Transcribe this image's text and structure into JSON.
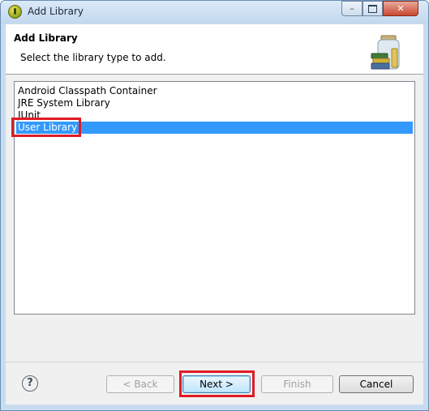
{
  "window": {
    "title": "Add Library",
    "controls": {
      "minimize": "–",
      "close": "✕"
    }
  },
  "header": {
    "title": "Add Library",
    "description": "Select the library type to add."
  },
  "library_types": {
    "items": [
      {
        "label": "Android Classpath Container",
        "selected": false
      },
      {
        "label": "JRE System Library",
        "selected": false
      },
      {
        "label": "JUnit",
        "selected": false
      },
      {
        "label": "User Library",
        "selected": true
      }
    ]
  },
  "footer": {
    "help_label": "?",
    "back_label": "< Back",
    "next_label": "Next >",
    "finish_label": "Finish",
    "cancel_label": "Cancel"
  },
  "colors": {
    "selection": "#3399ff",
    "highlight": "#e01b24",
    "titlebar": "#c8dcf0"
  }
}
